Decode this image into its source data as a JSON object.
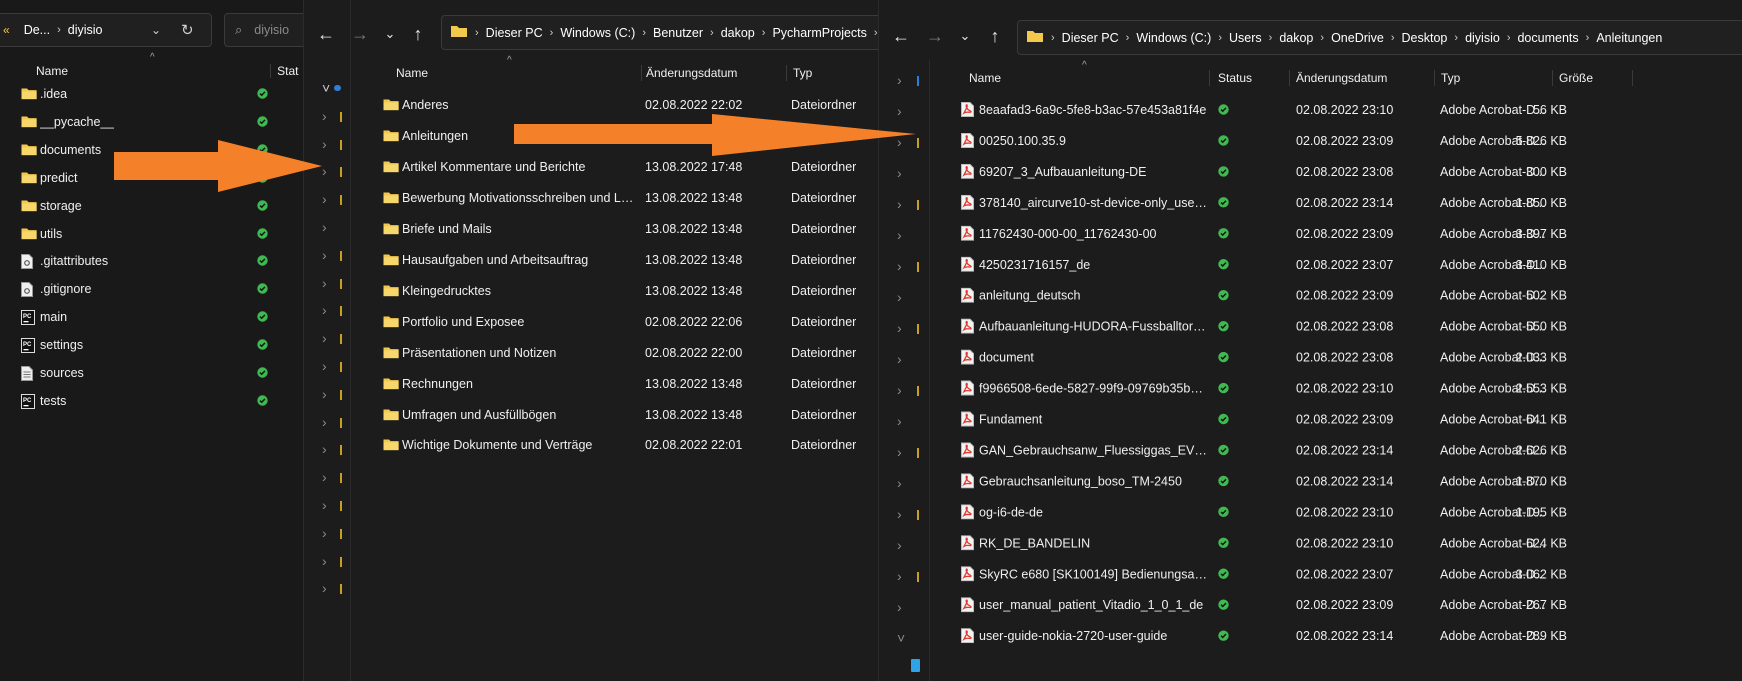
{
  "window1": {
    "breadcrumb": [
      "De...",
      "diyisio"
    ],
    "search_placeholder": "diyisio",
    "columns": {
      "name": "Name",
      "status": "Stat"
    },
    "items": [
      {
        "name": ".idea",
        "type": "folder"
      },
      {
        "name": "__pycache__",
        "type": "folder"
      },
      {
        "name": "documents",
        "type": "folder"
      },
      {
        "name": "predict",
        "type": "folder"
      },
      {
        "name": "storage",
        "type": "folder"
      },
      {
        "name": "utils",
        "type": "folder"
      },
      {
        "name": ".gitattributes",
        "type": "file"
      },
      {
        "name": ".gitignore",
        "type": "file"
      },
      {
        "name": "main",
        "type": "py"
      },
      {
        "name": "settings",
        "type": "py"
      },
      {
        "name": "sources",
        "type": "text"
      },
      {
        "name": "tests",
        "type": "py"
      }
    ]
  },
  "window2": {
    "breadcrumb": [
      "Dieser PC",
      "Windows (C:)",
      "Benutzer",
      "dakop",
      "PycharmProjects"
    ],
    "columns": {
      "name": "Name",
      "date": "Änderungsdatum",
      "type": "Typ"
    },
    "items": [
      {
        "name": "Anderes",
        "date": "02.08.2022 22:02",
        "type": "Dateiordner"
      },
      {
        "name": "Anleitungen",
        "date": "",
        "type": ""
      },
      {
        "name": "Artikel Kommentare und Berichte",
        "date": "13.08.2022 17:48",
        "type": "Dateiordner"
      },
      {
        "name": "Bewerbung Motivationsschreiben und Le...",
        "date": "13.08.2022 13:48",
        "type": "Dateiordner"
      },
      {
        "name": "Briefe und Mails",
        "date": "13.08.2022 13:48",
        "type": "Dateiordner"
      },
      {
        "name": "Hausaufgaben und Arbeitsauftrag",
        "date": "13.08.2022 13:48",
        "type": "Dateiordner"
      },
      {
        "name": "Kleingedrucktes",
        "date": "13.08.2022 13:48",
        "type": "Dateiordner"
      },
      {
        "name": "Portfolio und Exposee",
        "date": "02.08.2022 22:06",
        "type": "Dateiordner"
      },
      {
        "name": "Präsentationen und Notizen",
        "date": "02.08.2022 22:00",
        "type": "Dateiordner"
      },
      {
        "name": "Rechnungen",
        "date": "13.08.2022 13:48",
        "type": "Dateiordner"
      },
      {
        "name": "Umfragen und Ausfüllbögen",
        "date": "13.08.2022 13:48",
        "type": "Dateiordner"
      },
      {
        "name": "Wichtige Dokumente und Verträge",
        "date": "02.08.2022 22:01",
        "type": "Dateiordner"
      }
    ]
  },
  "window3": {
    "breadcrumb": [
      "Dieser PC",
      "Windows (C:)",
      "Users",
      "dakop",
      "OneDrive",
      "Desktop",
      "diyisio",
      "documents",
      "Anleitungen"
    ],
    "columns": {
      "name": "Name",
      "status": "Status",
      "date": "Änderungsdatum",
      "type": "Typ",
      "size": "Größe"
    },
    "items": [
      {
        "name": "8eaafad3-6a9c-5fe8-b3ac-57e453a81f4e",
        "date": "02.08.2022 23:10",
        "type": "Adobe Acrobat-D...",
        "size": "56 KB"
      },
      {
        "name": "00250.100.35.9",
        "date": "02.08.2022 23:09",
        "type": "Adobe Acrobat-D...",
        "size": "5.826 KB"
      },
      {
        "name": "69207_3_Aufbauanleitung-DE",
        "date": "02.08.2022 23:08",
        "type": "Adobe Acrobat-D...",
        "size": "300 KB"
      },
      {
        "name": "378140_aircurve10-st-device-only_user-g...",
        "date": "02.08.2022 23:14",
        "type": "Adobe Acrobat-D...",
        "size": "1.850 KB"
      },
      {
        "name": "11762430-000-00_11762430-00",
        "date": "02.08.2022 23:09",
        "type": "Adobe Acrobat-D...",
        "size": "3.397 KB"
      },
      {
        "name": "4250231716157_de",
        "date": "02.08.2022 23:07",
        "type": "Adobe Acrobat-D...",
        "size": "3.410 KB"
      },
      {
        "name": "anleitung_deutsch",
        "date": "02.08.2022 23:09",
        "type": "Adobe Acrobat-D...",
        "size": "502 KB"
      },
      {
        "name": "Aufbauanleitung-HUDORA-Fussballtor-T...",
        "date": "02.08.2022 23:08",
        "type": "Adobe Acrobat-D...",
        "size": "550 KB"
      },
      {
        "name": "document",
        "date": "02.08.2022 23:08",
        "type": "Adobe Acrobat-D...",
        "size": "2.033 KB"
      },
      {
        "name": "f9966508-6ede-5827-99f9-09769b35b0c4",
        "date": "02.08.2022 23:10",
        "type": "Adobe Acrobat-D...",
        "size": "2.553 KB"
      },
      {
        "name": "Fundament",
        "date": "02.08.2022 23:09",
        "type": "Adobe Acrobat-D...",
        "size": "641 KB"
      },
      {
        "name": "GAN_Gebrauchsanw_Fluessiggas_EV1508...",
        "date": "02.08.2022 23:14",
        "type": "Adobe Acrobat-D...",
        "size": "2.626 KB"
      },
      {
        "name": "Gebrauchsanleitung_boso_TM-2450",
        "date": "02.08.2022 23:14",
        "type": "Adobe Acrobat-D...",
        "size": "1.870 KB"
      },
      {
        "name": "og-i6-de-de",
        "date": "02.08.2022 23:10",
        "type": "Adobe Acrobat-D...",
        "size": "1.195 KB"
      },
      {
        "name": "RK_DE_BANDELIN",
        "date": "02.08.2022 23:10",
        "type": "Adobe Acrobat-D...",
        "size": "624 KB"
      },
      {
        "name": "SkyRC e680 [SK100149] Bedienungsanleit...",
        "date": "02.08.2022 23:07",
        "type": "Adobe Acrobat-D...",
        "size": "3.062 KB"
      },
      {
        "name": "user_manual_patient_Vitadio_1_0_1_de",
        "date": "02.08.2022 23:09",
        "type": "Adobe Acrobat-D...",
        "size": "267 KB"
      },
      {
        "name": "user-guide-nokia-2720-user-guide",
        "date": "02.08.2022 23:14",
        "type": "Adobe Acrobat-D...",
        "size": "289 KB"
      }
    ]
  },
  "colors": {
    "arrow": "#f5802a",
    "folder": "#f2c94c",
    "status_ok": "#3fb950",
    "pdf": "#e03a2f"
  }
}
